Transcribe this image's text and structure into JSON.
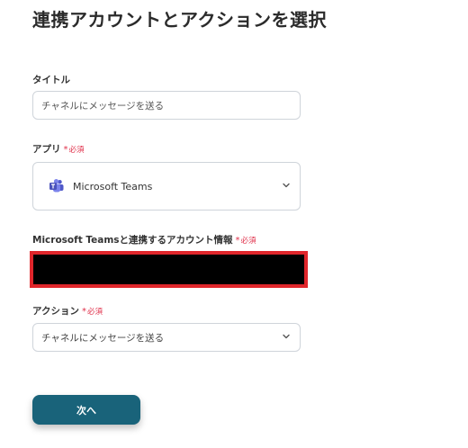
{
  "page": {
    "title": "連携アカウントとアクションを選択"
  },
  "form": {
    "title_field": {
      "label": "タイトル",
      "value": "チャネルにメッセージを送る"
    },
    "app_field": {
      "label": "アプリ",
      "required_mark": "*",
      "required_text": "必須",
      "value": "Microsoft Teams",
      "icon": "microsoft-teams-icon"
    },
    "account_field": {
      "label": "Microsoft Teamsと連携するアカウント情報",
      "required_mark": "*",
      "required_text": "必須"
    },
    "action_field": {
      "label": "アクション",
      "required_mark": "*",
      "required_text": "必須",
      "value": "チャネルにメッセージを送る"
    }
  },
  "buttons": {
    "next_label": "次へ"
  },
  "colors": {
    "required": "#e0314b",
    "primary_button": "#19637a",
    "redaction_border": "#e0262b"
  }
}
